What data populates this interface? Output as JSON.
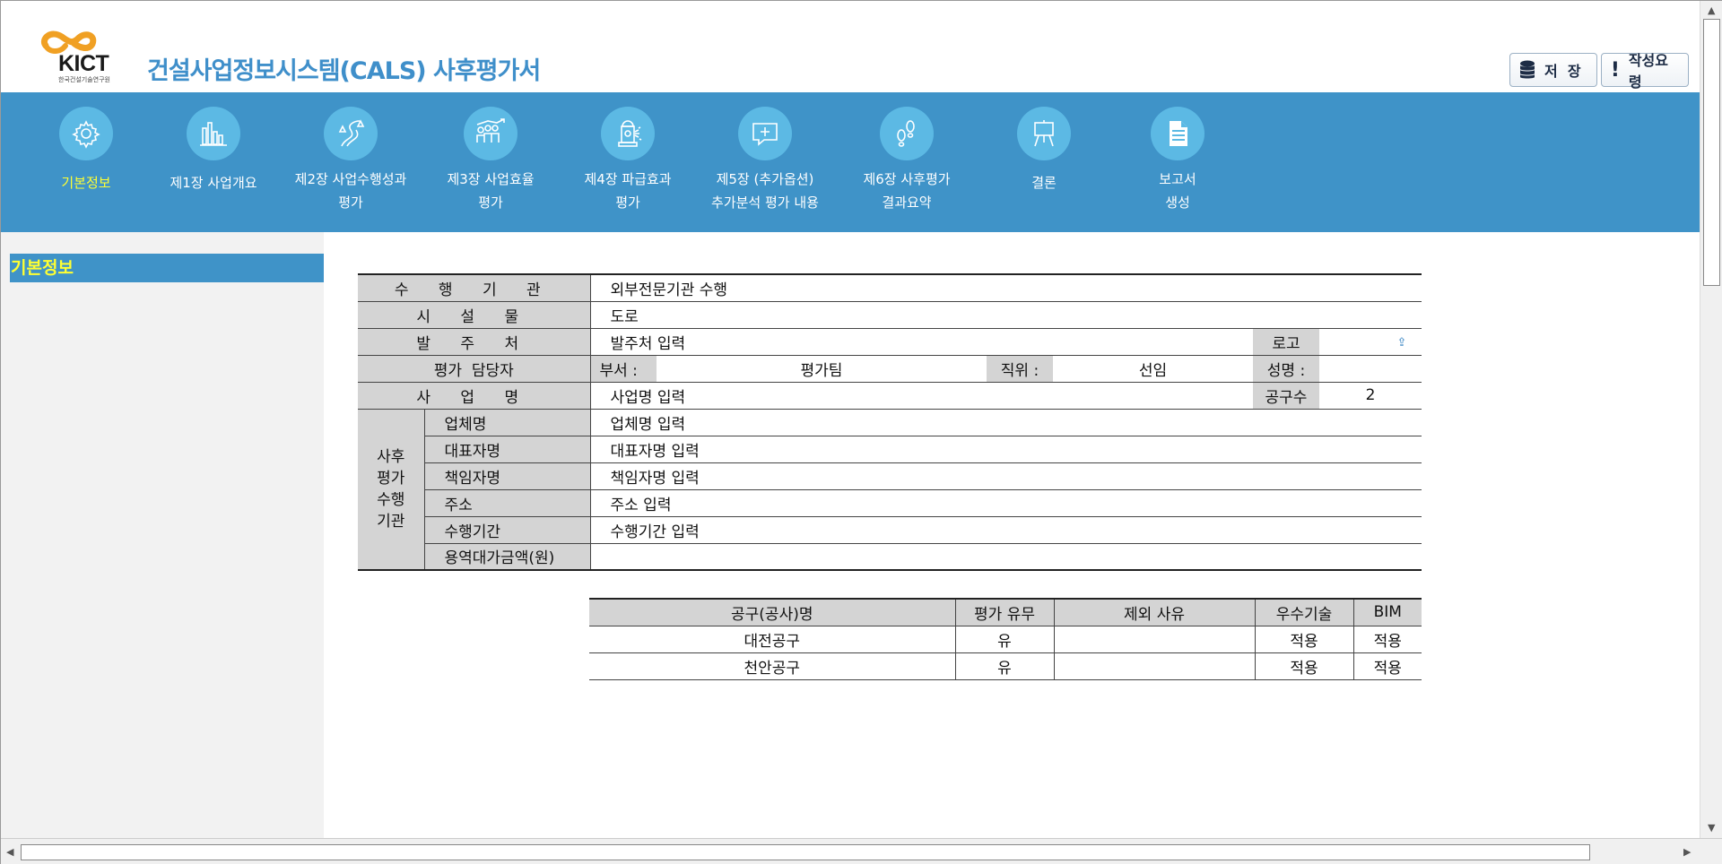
{
  "header": {
    "org_short": "KICT",
    "org_full": "한국건설기술연구원",
    "title": "건설사업정보시스템(CALS) 사후평가서",
    "save_label": "저  장",
    "guide_label": "작성요령"
  },
  "nav": {
    "items": [
      {
        "label": "기본정보",
        "icon": "gear-icon",
        "active": true
      },
      {
        "label": "제1장 사업개요",
        "icon": "bar-chart-icon"
      },
      {
        "label": "제2장 사업수행성과\n평가",
        "icon": "road-icon"
      },
      {
        "label": "제3장 사업효율\n평가",
        "icon": "people-growth-icon"
      },
      {
        "label": "제4장 파급효과\n평가",
        "icon": "hydrant-icon"
      },
      {
        "label": "제5장 (추가옵션)\n추가분석 평가 내용",
        "icon": "chat-plus-icon"
      },
      {
        "label": "제6장 사후평가\n결과요약",
        "icon": "footprints-icon"
      },
      {
        "label": "결론",
        "icon": "easel-icon"
      },
      {
        "label": "보고서\n생성",
        "icon": "document-icon"
      }
    ]
  },
  "sidebar": {
    "title": "기본정보"
  },
  "info": {
    "agency_label": "수 행  기 관",
    "agency_value": "외부전문기관 수행",
    "facility_label": "시  설  물",
    "facility_value": "도로",
    "client_label": "발  주  처",
    "client_value": "발주처 입력",
    "logo_label": "로고",
    "evaluator_label": "평가  담당자",
    "dept_label": "부서 :",
    "dept_value": "평가팀",
    "position_label": "직위 :",
    "position_value": "선임",
    "name_label": "성명 :",
    "name_value": "",
    "project_label": "사  업  명",
    "project_value": "사업명 입력",
    "sections_label": "공구수",
    "sections_value": "2",
    "org_group_label": "사후\n평가\n수행\n기관",
    "company_label": "업체명",
    "company_value": "업체명 입력",
    "ceo_label": "대표자명",
    "ceo_value": "대표자명 입력",
    "manager_label": "책임자명",
    "manager_value": "책임자명 입력",
    "address_label": "주소",
    "address_value": "주소 입력",
    "period_label": "수행기간",
    "period_value": "수행기간 입력",
    "fee_label": "용역대가금액(원)",
    "fee_value": ""
  },
  "work_table": {
    "headers": [
      "공구(공사)명",
      "평가 유무",
      "제외 사유",
      "우수기술",
      "BIM"
    ],
    "rows": [
      [
        "대전공구",
        "유",
        "",
        "적용",
        "적용"
      ],
      [
        "천안공구",
        "유",
        "",
        "적용",
        "적용"
      ]
    ]
  },
  "colors": {
    "nav_bg": "#3f93c8",
    "nav_circle": "#5cb9e4",
    "active_label": "#ffff33",
    "title": "#3f8fca",
    "logo_orange": "#f0a023"
  }
}
